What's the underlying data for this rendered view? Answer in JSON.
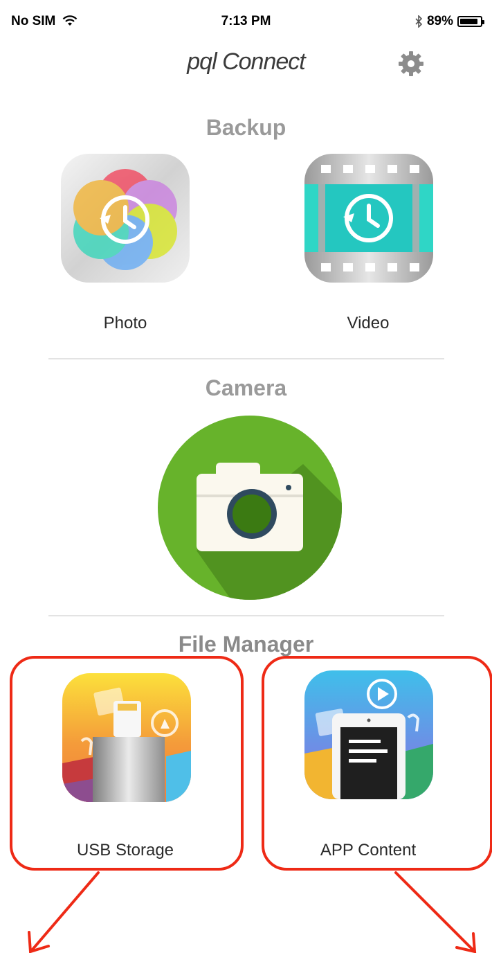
{
  "status_bar": {
    "carrier": "No SIM",
    "time": "7:13 PM",
    "battery": "89%",
    "battery_level": 0.89,
    "icons": [
      "wifi-icon",
      "bluetooth-icon",
      "battery-icon"
    ]
  },
  "header": {
    "brand": "pql Connect",
    "settings_icon": "gear-icon"
  },
  "sections": {
    "backup": {
      "title": "Backup",
      "items": [
        {
          "label": "Photo",
          "icon": "photo-backup-icon"
        },
        {
          "label": "Video",
          "icon": "video-backup-icon"
        }
      ]
    },
    "camera": {
      "title": "Camera",
      "icon": "camera-icon"
    },
    "file_manager": {
      "title": "File Manager",
      "items": [
        {
          "label": "USB Storage",
          "icon": "usb-storage-icon"
        },
        {
          "label": "APP Content",
          "icon": "app-content-icon"
        }
      ]
    }
  },
  "annotation_colors": {
    "highlight": "#ee2a16",
    "camera_green": "#67b32b",
    "video_teal": "#2fd6c6"
  }
}
